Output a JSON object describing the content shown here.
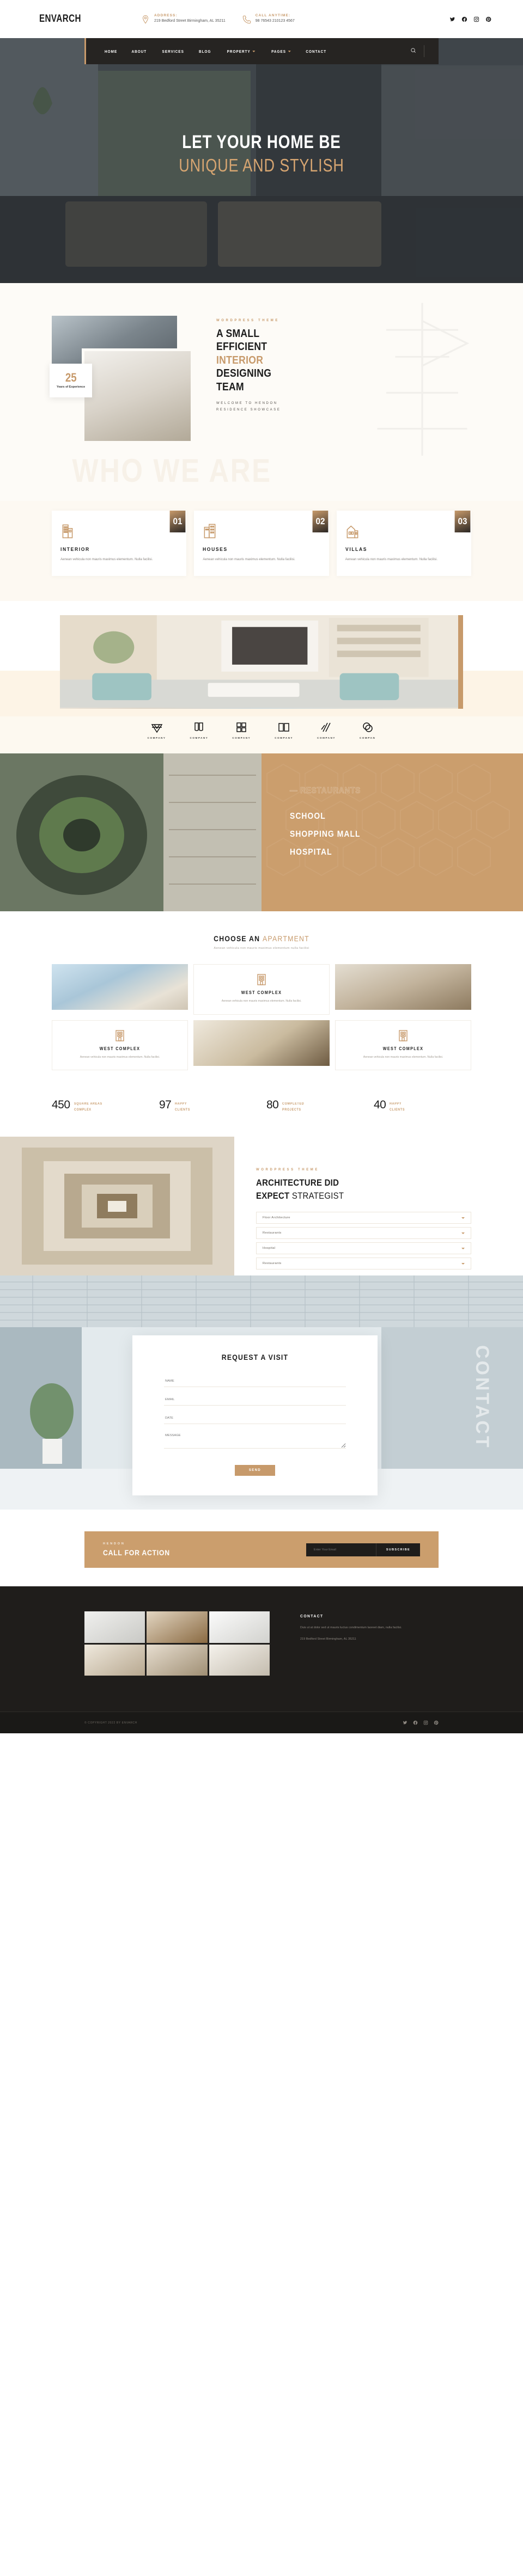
{
  "topbar": {
    "logo": "ENVARCH",
    "address_label": "ADDRESS:",
    "address_value": "219 Bedford Street Birmingham, AL 35211",
    "phone_label": "CALL ANYTIME:",
    "phone_value": "98 76543 210123 4567",
    "socials": [
      "twitter-icon",
      "facebook-icon",
      "instagram-icon",
      "pinterest-icon"
    ]
  },
  "nav": {
    "items": [
      {
        "label": "HOME",
        "has_dropdown": false
      },
      {
        "label": "ABOUT",
        "has_dropdown": false
      },
      {
        "label": "SERVICES",
        "has_dropdown": false
      },
      {
        "label": "BLOG",
        "has_dropdown": false
      },
      {
        "label": "PROPERTY",
        "has_dropdown": true
      },
      {
        "label": "PAGES",
        "has_dropdown": true
      },
      {
        "label": "CONTACT",
        "has_dropdown": false
      }
    ],
    "search_icon": "search-icon"
  },
  "hero": {
    "line1": "LET YOUR HOME BE",
    "line2": "UNIQUE AND STYLISH"
  },
  "about": {
    "ghost_text": "WHO WE ARE",
    "badge_number": "25",
    "badge_text": "Years of Experience",
    "eyebrow": "WORDPRESS THEME",
    "h_line1": "A SMALL",
    "h_line2": "EFFICIENT",
    "h_line3": "INTERIOR",
    "h_line4": "DESIGNING",
    "h_line5": "TEAM",
    "sub_line1": "WELCOME TO HENDON",
    "sub_line2": "RESIDENCE SHOWCASE"
  },
  "services": [
    {
      "number": "01",
      "title": "INTERIOR",
      "desc": "Aenean vehicula non mauris maximus elementum. Nulla facilisi.",
      "icon": "building-icon"
    },
    {
      "number": "02",
      "title": "HOUSES",
      "desc": "Aenean vehicula non mauris maximus elementum. Nulla facilisi.",
      "icon": "office-icon"
    },
    {
      "number": "03",
      "title": "VILLAS",
      "desc": "Aenean vehicula non mauris maximus elementum. Nulla facilisi.",
      "icon": "villa-icon"
    }
  ],
  "partners": [
    {
      "label": "COMPANY",
      "icon": "triangles-logo-icon"
    },
    {
      "label": "COMPANY",
      "icon": "shield-logo-icon"
    },
    {
      "label": "COMPANY",
      "icon": "blocks-logo-icon"
    },
    {
      "label": "COMPANY",
      "icon": "book-logo-icon"
    },
    {
      "label": "COMPANY",
      "icon": "strokes-logo-icon"
    },
    {
      "label": "COMPAN",
      "icon": "circles-logo-icon"
    }
  ],
  "category": {
    "eyebrow": "— RESTAURANTS",
    "line1": "SCHOOL",
    "line2": "SHOPPING MALL",
    "line3": "HOSPITAL"
  },
  "apartments": {
    "title_dark": "CHOOSE AN",
    "title_gold": "APARTMENT",
    "subtitle": "Aenean vehicula non mauris maximus elementum nulla facilisi",
    "cards": [
      {
        "title": "WEST COMPLEX",
        "desc": "Aenean vehicula non mauris maximus elementum. Nulla facilisi.",
        "icon": "apartment-icon"
      },
      {
        "title": "WEST COMPLEX",
        "desc": "Aenean vehicula non mauris maximus elementum. Nulla facilisi.",
        "icon": "apartment-icon"
      },
      {
        "title": "WEST COMPLEX",
        "desc": "Aenean vehicula non mauris maximus elementum. Nulla facilisi.",
        "icon": "apartment-icon"
      }
    ]
  },
  "counters": [
    {
      "number": "450",
      "label1": "SQUARE AREAS",
      "label2": "COMPLEX"
    },
    {
      "number": "97",
      "label1": "HAPPY",
      "label2": "CLIENTS"
    },
    {
      "number": "80",
      "label1": "COMPLETED",
      "label2": "PROJECTS"
    },
    {
      "number": "40",
      "label1": "HAPPY",
      "label2": "CLIENTS"
    }
  ],
  "accordion": {
    "eyebrow": "WORDPRESS THEME",
    "h_line1": "ARCHITECTURE DID",
    "h_bold2": "EXPECT",
    "h_light2": "STRATEGIST",
    "items": [
      {
        "question": "Floor Architecture"
      },
      {
        "question": "Restaurants"
      },
      {
        "question": "Hospital"
      },
      {
        "question": "Restaurants"
      }
    ]
  },
  "contact": {
    "watermark": "CONTACT",
    "title": "REQUEST A VISIT",
    "fields": [
      {
        "name": "name-field",
        "placeholder": "NAME"
      },
      {
        "name": "email-field",
        "placeholder": "EMAIL"
      },
      {
        "name": "date-field",
        "placeholder": "DATE"
      },
      {
        "name": "message-field",
        "placeholder": "MESSAGE"
      }
    ],
    "submit_label": "Send"
  },
  "cta": {
    "eyebrow": "HENDON",
    "title": "CALL FOR ACTION",
    "input_placeholder": "Enter Your Email",
    "button_label": "SUBSCRIBE"
  },
  "footer": {
    "heading": "CONTACT",
    "text": "Duis ut at dolor sed ut mauris luctus condimentum laoreet diam, nulla facilisi.",
    "address": "219 Bedford Street Birmingham, AL 35211",
    "copyright": "© COPYRIGHT 2022 BY  ENVARCH",
    "socials": [
      "twitter-icon",
      "facebook-icon",
      "instagram-icon",
      "pinterest-icon"
    ]
  },
  "colors": {
    "gold": "#c79a6b",
    "dark": "#1f1d1b",
    "cream": "#fdf9f2"
  }
}
